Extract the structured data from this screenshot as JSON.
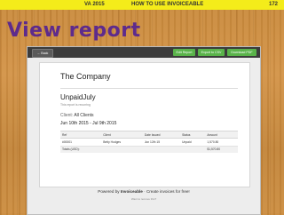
{
  "header": {
    "course": "VA 2015",
    "topic": "HOW TO USE INVOICEABLE",
    "page": "172"
  },
  "slide_title": "View report",
  "toolbar": {
    "back_label": "← Back",
    "edit_label": "Edit Report",
    "csv_label": "Export to CSV",
    "pdf_label": "Download PDF"
  },
  "report": {
    "company": "The Company",
    "name": "UnpaidJuly",
    "note": "This report is recurring",
    "client_label": "Client:",
    "client_value": "All Clients",
    "date_range": "Jun 10th 2015 - Jul 9th 2015",
    "table": {
      "headers": [
        "Ref",
        "Client",
        "Date Issued",
        "Status",
        "Amount"
      ],
      "rows": [
        [
          "#00001",
          "Betty Hodges",
          "Jun 12th 15",
          "Unpaid",
          "1,570.80"
        ]
      ],
      "totals_label": "Totals (USD):",
      "totals_value": "$1,570.80"
    }
  },
  "footer": {
    "powered_prefix": "Powered by",
    "brand": "Invoiceable",
    "powered_suffix": "· Create invoices for free!",
    "small_link": "Want to remove this?"
  },
  "colors": {
    "topbar": "#f4ec1a",
    "title": "#5e2b8c",
    "toolbar_button_green": "#59b34a",
    "toolbar": "#3c3c3c"
  }
}
